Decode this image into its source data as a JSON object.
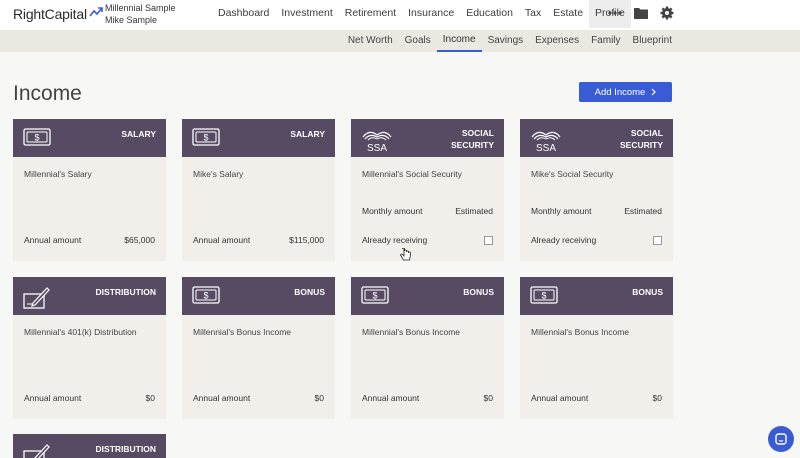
{
  "header": {
    "logo_text": "RightCapital",
    "client1": "Millennial Sample",
    "client2": "Mike Sample",
    "nav": [
      "Dashboard",
      "Investment",
      "Retirement",
      "Insurance",
      "Education",
      "Tax",
      "Estate",
      "Profile"
    ],
    "active_nav": "Profile"
  },
  "subnav": [
    "Net Worth",
    "Goals",
    "Income",
    "Savings",
    "Expenses",
    "Family",
    "Blueprint"
  ],
  "page": {
    "title": "Income",
    "add_button": "Add Income"
  },
  "cards": [
    {
      "type": "SALARY",
      "icon": "dollar-bill-icon",
      "name": "Millennial's Salary",
      "label": "Annual amount",
      "value": "$65,000"
    },
    {
      "type": "SALARY",
      "icon": "dollar-bill-icon",
      "name": "Mike's Salary",
      "label": "Annual amount",
      "value": "$115,000"
    },
    {
      "type_line1": "SOCIAL",
      "type_line2": "SECURITY",
      "icon": "ssa-icon",
      "icon_text": "SSA",
      "name": "Millennial's Social Security",
      "label1": "Monthly amount",
      "value1": "Estimated",
      "label2": "Already receiving"
    },
    {
      "type_line1": "SOCIAL",
      "type_line2": "SECURITY",
      "icon": "ssa-icon",
      "icon_text": "SSA",
      "name": "Mike's Social Security",
      "label1": "Monthly amount",
      "value1": "Estimated",
      "label2": "Already receiving"
    },
    {
      "type": "DISTRIBUTION",
      "icon": "check-pen-icon",
      "name": "Millennial's 401(k) Distribution",
      "label": "Annual amount",
      "value": "$0"
    },
    {
      "type": "BONUS",
      "icon": "dollar-bill-icon",
      "name": "Millennial's Bonus Income",
      "label": "Annual amount",
      "value": "$0"
    },
    {
      "type": "BONUS",
      "icon": "dollar-bill-icon",
      "name": "Millennial's Bonus Income",
      "label": "Annual amount",
      "value": "$0"
    },
    {
      "type": "BONUS",
      "icon": "dollar-bill-icon",
      "name": "Millennial's Bonus Income",
      "label": "Annual amount",
      "value": "$0"
    },
    {
      "type": "DISTRIBUTION",
      "icon": "check-pen-icon"
    }
  ],
  "colors": {
    "card_header": "#574b64",
    "accent": "#3a5bd6",
    "card_body": "#f1efea"
  }
}
